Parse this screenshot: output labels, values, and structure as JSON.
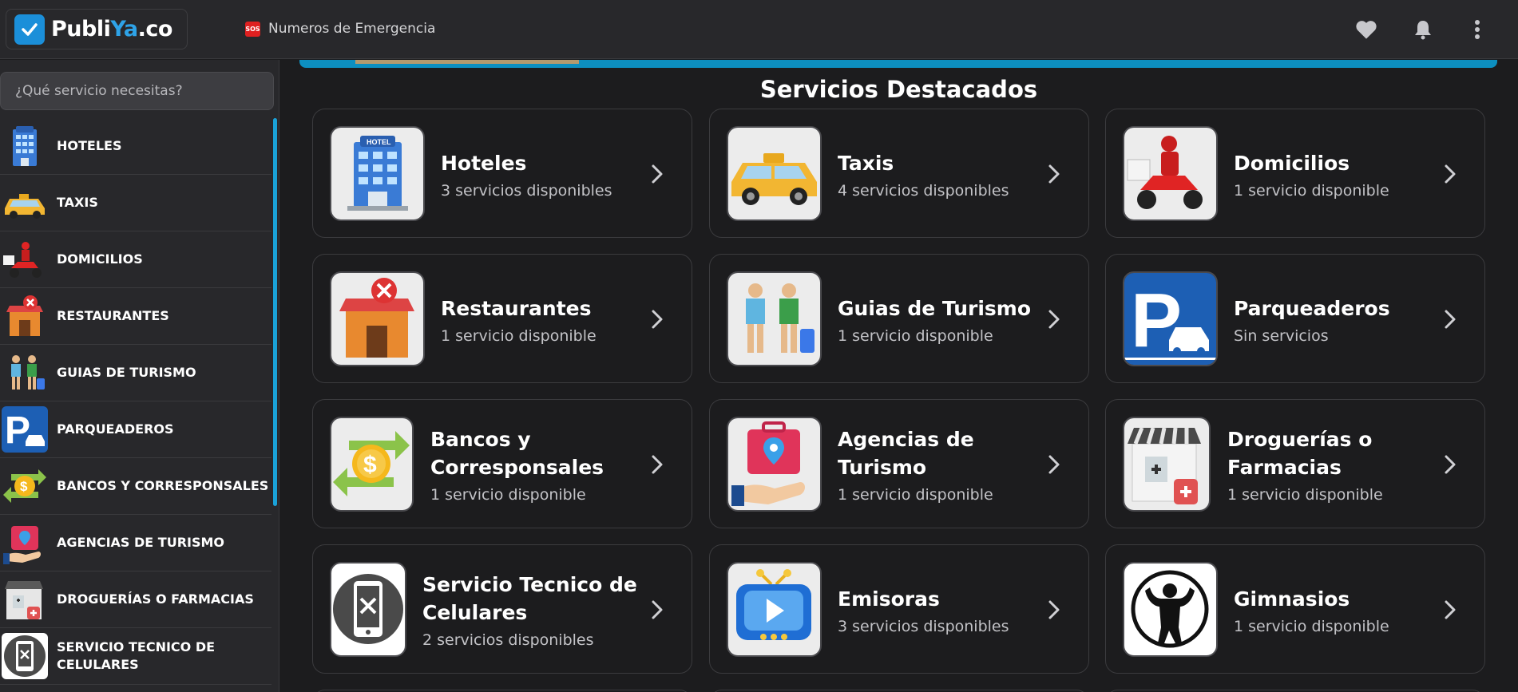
{
  "header": {
    "logo_part1": "Publi",
    "logo_part2": "Ya",
    "logo_part3": ".co",
    "emergency_label": "Numeros de Emergencia",
    "sos_badge": "SOS"
  },
  "sidebar": {
    "search_placeholder": "¿Qué servicio necesitas?",
    "items": [
      {
        "label": "HOTELES",
        "icon": "hotel-icon"
      },
      {
        "label": "TAXIS",
        "icon": "taxi-icon"
      },
      {
        "label": "DOMICILIOS",
        "icon": "delivery-icon"
      },
      {
        "label": "RESTAURANTES",
        "icon": "restaurant-icon"
      },
      {
        "label": "GUIAS DE TURISMO",
        "icon": "tour-guide-icon"
      },
      {
        "label": "PARQUEADEROS",
        "icon": "parking-icon"
      },
      {
        "label": "BANCOS Y CORRESPONSALES",
        "icon": "bank-icon"
      },
      {
        "label": "AGENCIAS DE TURISMO",
        "icon": "travel-agency-icon"
      },
      {
        "label": "DROGUERÍAS O FARMACIAS",
        "icon": "pharmacy-icon"
      },
      {
        "label": "SERVICIO TECNICO DE CELULARES",
        "icon": "phone-repair-icon"
      }
    ]
  },
  "main": {
    "section_title": "Servicios Destacados",
    "cards": [
      {
        "title": "Hoteles",
        "subtitle": "3 servicios disponibles"
      },
      {
        "title": "Taxis",
        "subtitle": "4 servicios disponibles"
      },
      {
        "title": "Domicilios",
        "subtitle": "1 servicio disponible"
      },
      {
        "title": "Restaurantes",
        "subtitle": "1 servicio disponible"
      },
      {
        "title": "Guias de Turismo",
        "subtitle": "1 servicio disponible"
      },
      {
        "title": "Parqueaderos",
        "subtitle": "Sin servicios"
      },
      {
        "title": "Bancos y Corresponsales",
        "subtitle": "1 servicio disponible"
      },
      {
        "title": "Agencias de Turismo",
        "subtitle": "1 servicio disponible"
      },
      {
        "title": "Droguerías o Farmacias",
        "subtitle": "1 servicio disponible"
      },
      {
        "title": "Servicio Tecnico de Celulares",
        "subtitle": "2 servicios disponibles"
      },
      {
        "title": "Emisoras",
        "subtitle": "3 servicios disponibles"
      },
      {
        "title": "Gimnasios",
        "subtitle": "1 servicio disponible"
      }
    ]
  },
  "colors": {
    "accent": "#1aa2d8",
    "background": "#1c1c1e",
    "panel": "#28282b"
  }
}
